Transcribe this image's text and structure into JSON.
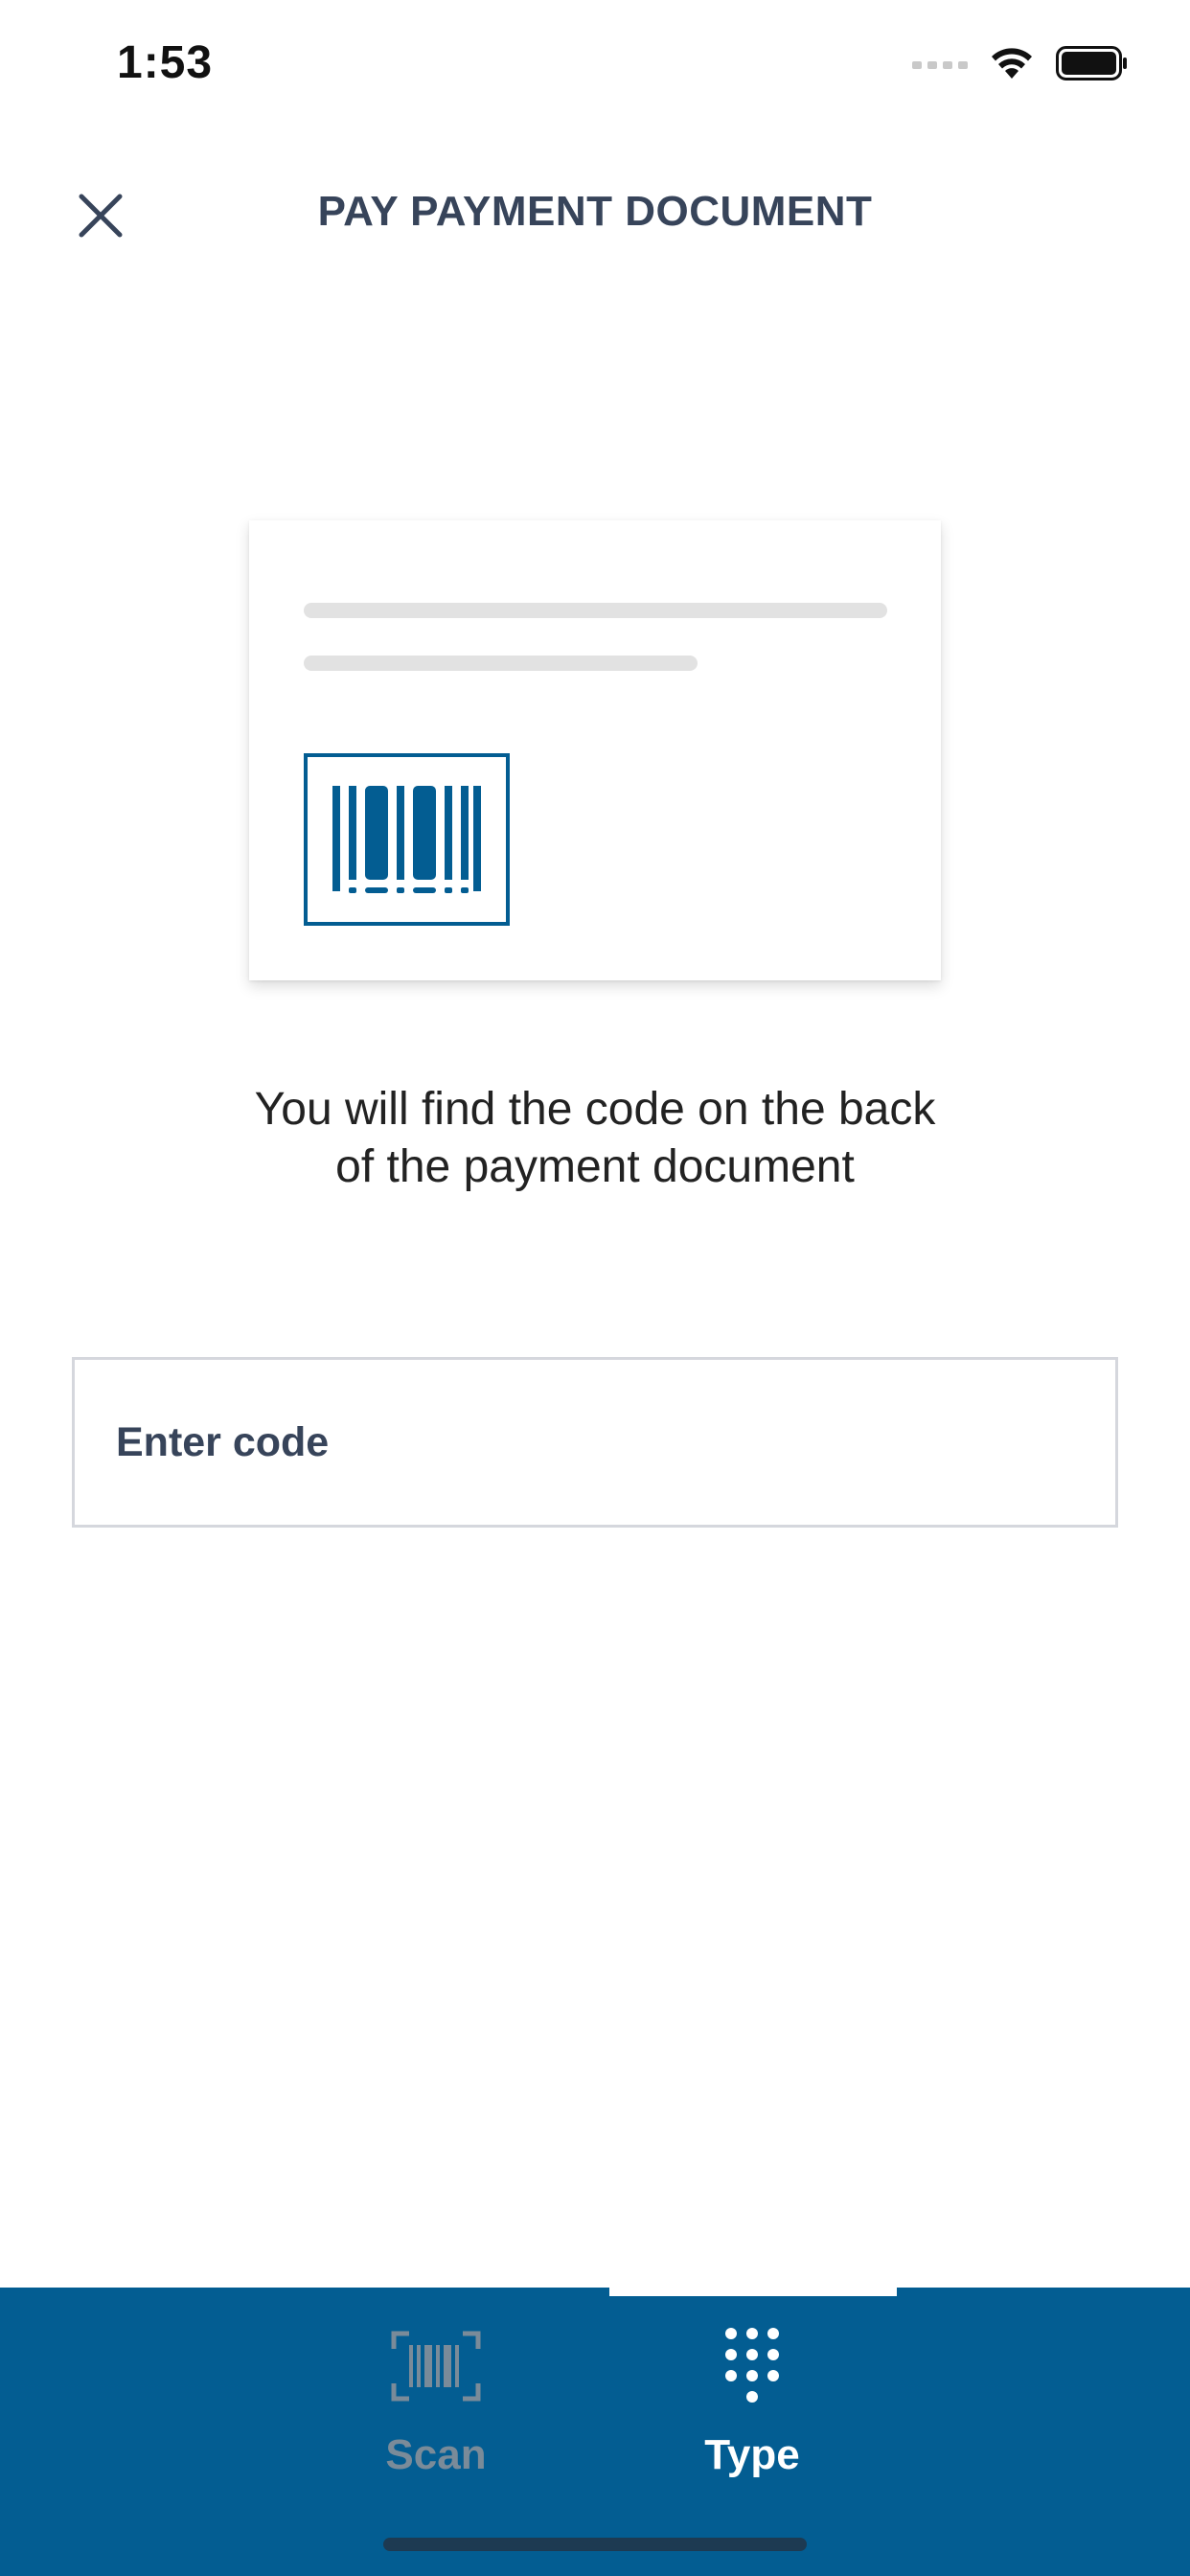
{
  "status_bar": {
    "time": "1:53",
    "icons": [
      "signal-icon",
      "wifi-icon",
      "battery-icon"
    ]
  },
  "header": {
    "title": "PAY PAYMENT DOCUMENT",
    "close_icon": "close-icon"
  },
  "illustration": {
    "barcode_icon": "barcode-icon",
    "accent_color": "#035d92"
  },
  "hint": {
    "line1": "You will find the code on the back",
    "line2": "of the payment document"
  },
  "code_input": {
    "placeholder": "Enter code",
    "value": ""
  },
  "bottom_tabs": {
    "background_color": "#035d92",
    "active": "type",
    "items": [
      {
        "id": "scan",
        "label": "Scan",
        "icon": "barcode-scan-icon"
      },
      {
        "id": "type",
        "label": "Type",
        "icon": "keypad-icon"
      }
    ]
  }
}
